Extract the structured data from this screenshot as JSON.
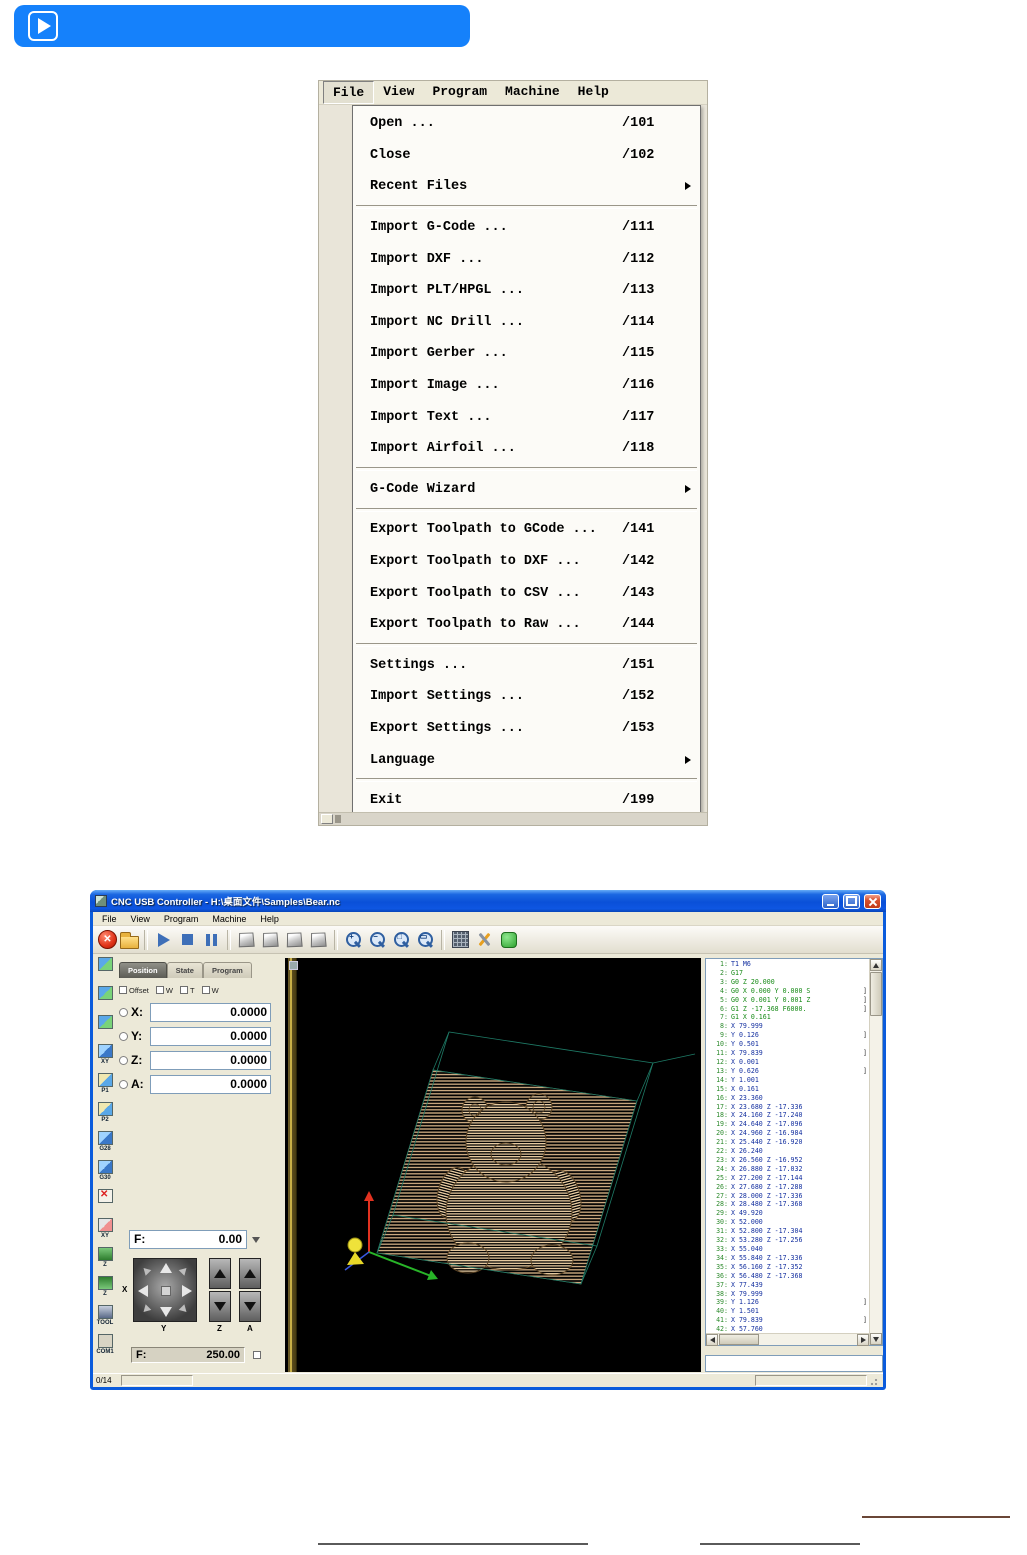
{
  "banner": {
    "icon": "play-icon"
  },
  "menu_screenshot": {
    "menubar": [
      {
        "label": "File",
        "state": "active"
      },
      {
        "label": "View"
      },
      {
        "label": "Program"
      },
      {
        "label": "Machine"
      },
      {
        "label": "Help"
      }
    ],
    "items": [
      {
        "type": "item",
        "label": "Open ...",
        "shortcut": "/101"
      },
      {
        "type": "item",
        "label": "Close",
        "shortcut": "/102"
      },
      {
        "type": "item",
        "label": "Recent Files",
        "submenu": "yes"
      },
      {
        "type": "separator"
      },
      {
        "type": "item",
        "label": "Import G-Code ...",
        "shortcut": "/111"
      },
      {
        "type": "item",
        "label": "Import DXF ...",
        "shortcut": "/112"
      },
      {
        "type": "item",
        "label": "Import PLT/HPGL ...",
        "shortcut": "/113"
      },
      {
        "type": "item",
        "label": "Import NC Drill ...",
        "shortcut": "/114"
      },
      {
        "type": "item",
        "label": "Import Gerber ...",
        "shortcut": "/115"
      },
      {
        "type": "item",
        "label": "Import Image ...",
        "shortcut": "/116"
      },
      {
        "type": "item",
        "label": "Import Text ...",
        "shortcut": "/117"
      },
      {
        "type": "item",
        "label": "Import Airfoil ...",
        "shortcut": "/118"
      },
      {
        "type": "separator"
      },
      {
        "type": "item",
        "label": "G-Code Wizard",
        "submenu": "yes"
      },
      {
        "type": "separator"
      },
      {
        "type": "item",
        "label": "Export Toolpath to GCode ...",
        "shortcut": "/141"
      },
      {
        "type": "item",
        "label": "Export Toolpath to DXF ...",
        "shortcut": "/142"
      },
      {
        "type": "item",
        "label": "Export Toolpath to CSV ...",
        "shortcut": "/143"
      },
      {
        "type": "item",
        "label": "Export Toolpath to Raw ...",
        "shortcut": "/144"
      },
      {
        "type": "separator"
      },
      {
        "type": "item",
        "label": "Settings ...",
        "shortcut": "/151"
      },
      {
        "type": "item",
        "label": "Import Settings ...",
        "shortcut": "/152"
      },
      {
        "type": "item",
        "label": "Export Settings ...",
        "shortcut": "/153"
      },
      {
        "type": "item",
        "label": "Language",
        "submenu": "yes"
      },
      {
        "type": "separator"
      },
      {
        "type": "item",
        "label": "Exit",
        "shortcut": "/199"
      }
    ]
  },
  "app": {
    "title": "CNC USB Controller - H:\\桌面文件\\Samples\\Bear.nc",
    "menubar": [
      "File",
      "View",
      "Program",
      "Machine",
      "Help"
    ],
    "toolbar_icons": [
      {
        "name": "emergency-stop-icon",
        "cls": "ic-estop"
      },
      {
        "name": "open-file-icon",
        "cls": "ic-open"
      },
      {
        "name": "toolbar-separator",
        "cls": "tbsep"
      },
      {
        "name": "play-icon",
        "cls": "ic-play"
      },
      {
        "name": "stop-icon",
        "cls": "ic-stop"
      },
      {
        "name": "pause-icon",
        "cls": "ic-pause"
      },
      {
        "name": "toolbar-separator",
        "cls": "tbsep"
      },
      {
        "name": "view-perspective-icon",
        "cls": "ic-cube"
      },
      {
        "name": "view-top-icon",
        "cls": "ic-cube"
      },
      {
        "name": "view-front-icon",
        "cls": "ic-cube"
      },
      {
        "name": "view-side-icon",
        "cls": "ic-cube"
      },
      {
        "name": "toolbar-separator",
        "cls": "tbsep"
      },
      {
        "name": "zoom-in-icon",
        "cls": "ic-zoom",
        "glyph": "+"
      },
      {
        "name": "zoom-out-icon",
        "cls": "ic-zoom",
        "glyph": "−"
      },
      {
        "name": "zoom-extents-icon",
        "cls": "ic-zoom",
        "glyph": "□"
      },
      {
        "name": "zoom-window-icon",
        "cls": "ic-zoom",
        "glyph": "▭"
      },
      {
        "name": "toolbar-separator",
        "cls": "tbsep"
      },
      {
        "name": "simulation-icon",
        "cls": "ic-sim"
      },
      {
        "name": "tools-settings-icon",
        "cls": "ic-tools"
      },
      {
        "name": "connect-machine-icon",
        "cls": "ic-plug"
      }
    ],
    "sidebar_icons": [
      {
        "label": "",
        "cls": "sb-grid"
      },
      {
        "label": "",
        "cls": "sb-grid"
      },
      {
        "label": "",
        "cls": "sb-grid"
      },
      {
        "label": "XY",
        "cls": "sb-g"
      },
      {
        "label": "P1",
        "cls": "sb-p"
      },
      {
        "label": "P2",
        "cls": "sb-p"
      },
      {
        "label": "G28",
        "cls": "sb-g"
      },
      {
        "label": "G30",
        "cls": "sb-g"
      },
      {
        "label": "",
        "cls": "sb-x"
      },
      {
        "label": "XY",
        "cls": "sb-xy0"
      },
      {
        "label": "Z",
        "cls": "sb-z1"
      },
      {
        "label": "Z",
        "cls": "sb-z2"
      },
      {
        "label": "TOOL",
        "cls": "sb-tool"
      },
      {
        "label": "COM1",
        "cls": "sb-com"
      }
    ],
    "panel": {
      "tabs": [
        {
          "label": "Position",
          "state": "active"
        },
        {
          "label": "State"
        },
        {
          "label": "Program"
        }
      ],
      "offset_checks": [
        {
          "label": "Offset"
        },
        {
          "label": "W"
        },
        {
          "label": "T"
        },
        {
          "label": "W"
        }
      ],
      "axes": [
        {
          "label": "X:",
          "value": "0.0000"
        },
        {
          "label": "Y:",
          "value": "0.0000"
        },
        {
          "label": "Z:",
          "value": "0.0000"
        },
        {
          "label": "A:",
          "value": "0.0000"
        }
      ],
      "feed_current": {
        "label": "F:",
        "value": "0.00"
      },
      "feed_set": {
        "label": "F:",
        "value": "250.00"
      },
      "jog": {
        "x": "X",
        "y": "Y",
        "z": "Z",
        "a": "A"
      }
    },
    "gcode": [
      {
        "n": "1:",
        "t": "T1 M6",
        "c": "m"
      },
      {
        "n": "2:",
        "t": "G17",
        "c": "g"
      },
      {
        "n": "3:",
        "t": "G0 Z 20.000",
        "c": "g"
      },
      {
        "n": "4:",
        "t": "G0 X 0.000 Y 0.000 S",
        "c": "g",
        "b": "]"
      },
      {
        "n": "5:",
        "t": "G0 X 0.001 Y 0.001 Z",
        "c": "g",
        "b": "]"
      },
      {
        "n": "6:",
        "t": "G1 Z -17.368 F6000.",
        "c": "g",
        "b": "]"
      },
      {
        "n": "7:",
        "t": "G1 X 0.161",
        "c": "g"
      },
      {
        "n": "8:",
        "t": "X 79.999",
        "c": "m"
      },
      {
        "n": "9:",
        "t": "Y 0.126",
        "c": "m",
        "b": "]"
      },
      {
        "n": "10:",
        "t": "Y 0.501",
        "c": "m"
      },
      {
        "n": "11:",
        "t": "X 79.839",
        "c": "m",
        "b": "]"
      },
      {
        "n": "12:",
        "t": "X 0.001",
        "c": "m"
      },
      {
        "n": "13:",
        "t": "Y 0.626",
        "c": "m",
        "b": "]"
      },
      {
        "n": "14:",
        "t": "Y 1.001",
        "c": "m"
      },
      {
        "n": "15:",
        "t": "X 0.161",
        "c": "m"
      },
      {
        "n": "16:",
        "t": "X 23.360",
        "c": "m"
      },
      {
        "n": "17:",
        "t": "X 23.680 Z -17.336",
        "c": "m"
      },
      {
        "n": "18:",
        "t": "X 24.160 Z -17.240",
        "c": "m"
      },
      {
        "n": "19:",
        "t": "X 24.640 Z -17.096",
        "c": "m"
      },
      {
        "n": "20:",
        "t": "X 24.960 Z -16.984",
        "c": "m"
      },
      {
        "n": "21:",
        "t": "X 25.440 Z -16.920",
        "c": "m"
      },
      {
        "n": "22:",
        "t": "X 26.240",
        "c": "m"
      },
      {
        "n": "23:",
        "t": "X 26.560 Z -16.952",
        "c": "m"
      },
      {
        "n": "24:",
        "t": "X 26.880 Z -17.032",
        "c": "m"
      },
      {
        "n": "25:",
        "t": "X 27.200 Z -17.144",
        "c": "m"
      },
      {
        "n": "26:",
        "t": "X 27.680 Z -17.288",
        "c": "m"
      },
      {
        "n": "27:",
        "t": "X 28.000 Z -17.336",
        "c": "m"
      },
      {
        "n": "28:",
        "t": "X 28.480 Z -17.368",
        "c": "m"
      },
      {
        "n": "29:",
        "t": "X 49.920",
        "c": "m"
      },
      {
        "n": "30:",
        "t": "X 52.000",
        "c": "m"
      },
      {
        "n": "31:",
        "t": "X 52.800 Z -17.304",
        "c": "m"
      },
      {
        "n": "32:",
        "t": "X 53.280 Z -17.256",
        "c": "m"
      },
      {
        "n": "33:",
        "t": "X 55.040",
        "c": "m"
      },
      {
        "n": "34:",
        "t": "X 55.840 Z -17.336",
        "c": "m"
      },
      {
        "n": "35:",
        "t": "X 56.160 Z -17.352",
        "c": "m"
      },
      {
        "n": "36:",
        "t": "X 56.480 Z -17.368",
        "c": "m"
      },
      {
        "n": "37:",
        "t": "X 77.439",
        "c": "m"
      },
      {
        "n": "38:",
        "t": "X 79.999",
        "c": "m"
      },
      {
        "n": "39:",
        "t": "Y 1.126",
        "c": "m",
        "b": "]"
      },
      {
        "n": "40:",
        "t": "Y 1.501",
        "c": "m"
      },
      {
        "n": "41:",
        "t": "X 79.839",
        "c": "m",
        "b": "]"
      },
      {
        "n": "42:",
        "t": "X 57.760",
        "c": "m"
      }
    ],
    "command_input": {
      "value": ""
    },
    "statusbar": {
      "left": "0/14"
    }
  }
}
